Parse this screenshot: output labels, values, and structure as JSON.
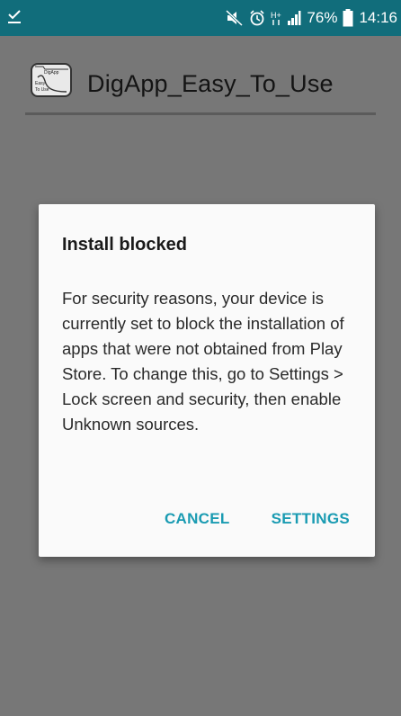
{
  "status_bar": {
    "battery": "76%",
    "time": "14:16",
    "icons": [
      "download-done-icon",
      "mute-icon",
      "alarm-icon",
      "data-h-plus-icon",
      "signal-icon",
      "battery-icon"
    ]
  },
  "app": {
    "title": "DigApp_Easy_To_Use",
    "logo": {
      "top_text": "DigApp",
      "line1": "Easy",
      "line2": "To Use"
    }
  },
  "dialog": {
    "title": "Install blocked",
    "message": "For security reasons, your device is currently set to block the installation of apps that were not obtained from Play Store. To change this, go to Settings > Lock screen and security, then enable Unknown sources.",
    "cancel_label": "CANCEL",
    "settings_label": "SETTINGS",
    "accent_color": "#1a9bb2"
  },
  "colors": {
    "status_bar": "#116d7b",
    "scrim": "#777777",
    "dialog_bg": "#fafafa"
  }
}
